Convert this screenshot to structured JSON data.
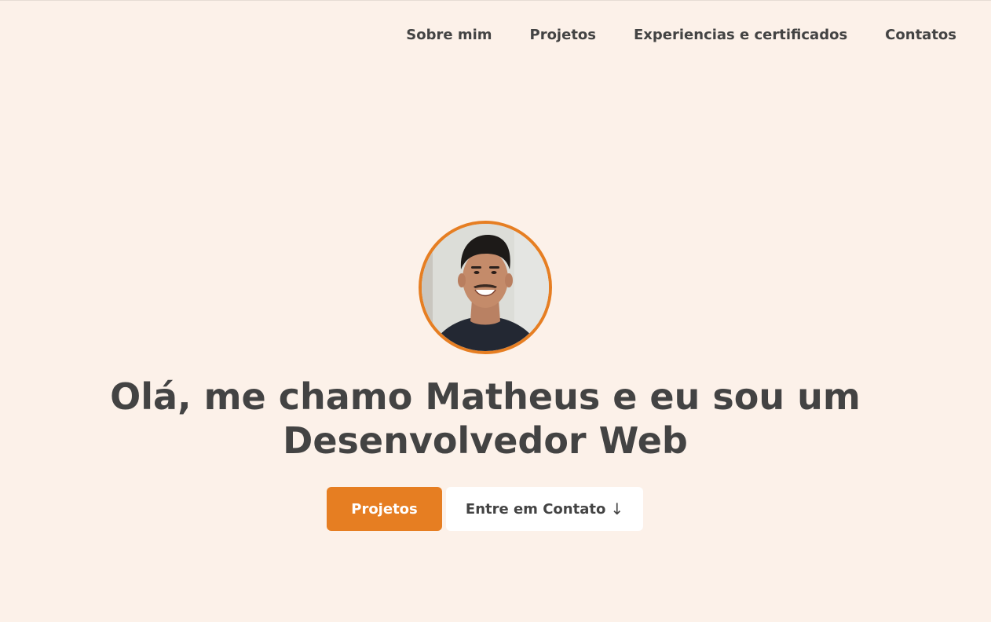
{
  "nav": {
    "items": [
      {
        "label": "Sobre mim"
      },
      {
        "label": "Projetos"
      },
      {
        "label": "Experiencias e certificados"
      },
      {
        "label": "Contatos"
      }
    ]
  },
  "hero": {
    "avatar_alt": "profile-photo",
    "headline_line1": "Olá, me chamo Matheus e eu sou um",
    "headline_line2": "Desenvolvedor Web",
    "primary_button": "Projetos",
    "secondary_button": "Entre em Contato",
    "secondary_icon": "↓"
  },
  "colors": {
    "background": "#fcf1e9",
    "accent": "#e67e22",
    "text": "#434343",
    "button_secondary_bg": "#ffffff"
  }
}
